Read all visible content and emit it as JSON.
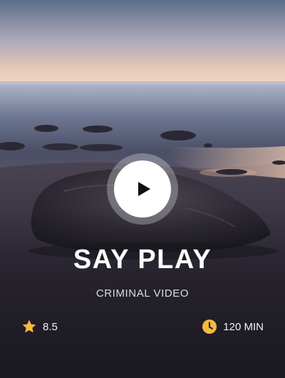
{
  "card": {
    "title": "SAY PLAY",
    "subtitle": "CRIMINAL VIDEO",
    "rating": "8.5",
    "duration": "120 MIN"
  },
  "icons": {
    "play": "play-icon",
    "rating": "star-icon",
    "duration": "clock-icon"
  },
  "colors": {
    "accent": "#f5b942",
    "text": "#ffffff",
    "subtext": "#dcdce2"
  }
}
